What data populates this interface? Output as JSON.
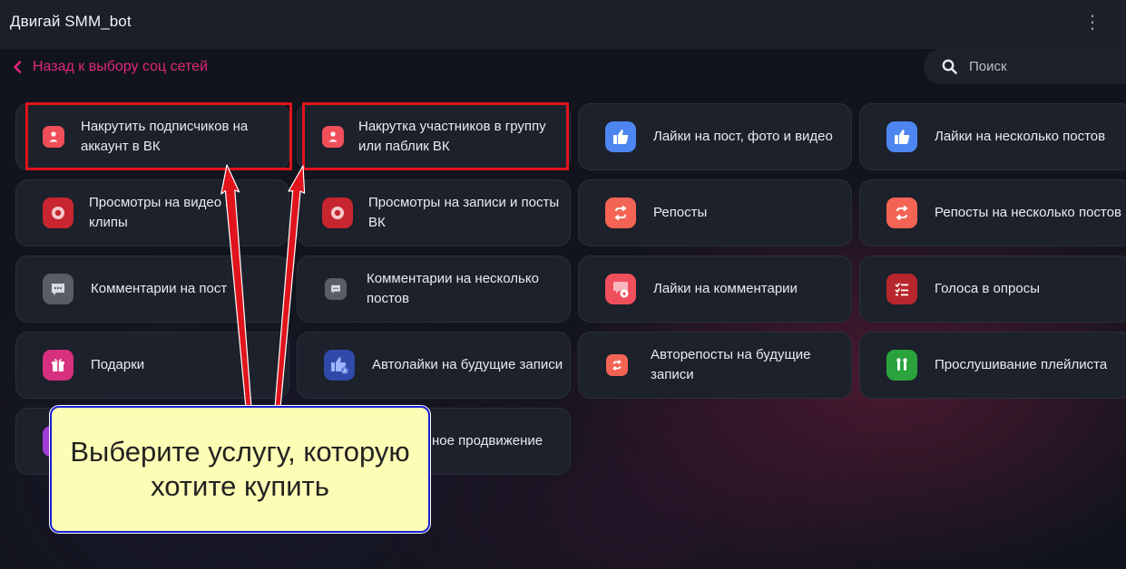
{
  "header": {
    "title": "Двигай SMM_bot",
    "menu_icon": "more-vertical-icon"
  },
  "back_link": {
    "label": "Назад к выбору соц сетей",
    "color": "#e0287a"
  },
  "search": {
    "placeholder": "Поиск"
  },
  "services": [
    {
      "label1": "Накрутить подписчиков на",
      "label2": "аккаунт в ВК",
      "icon": "user-icon"
    },
    {
      "label1": "Накрутка участников в группу",
      "label2": "или паблик ВК",
      "icon": "user-icon"
    },
    {
      "label1": "Лайки на пост, фото и видео",
      "icon": "thumbs-up-icon"
    },
    {
      "label1": "Лайки на несколько постов",
      "icon": "thumbs-up-icon"
    },
    {
      "label1": "Просмотры на видео и",
      "label2": "клипы",
      "icon": "eye-icon"
    },
    {
      "label1": "Просмотры на записи и посты",
      "label2": "ВК",
      "icon": "eye-icon"
    },
    {
      "label1": "Репосты",
      "icon": "repost-icon"
    },
    {
      "label1": "Репосты на несколько постов",
      "icon": "repost-icon"
    },
    {
      "label1": "Комментарии на пост",
      "icon": "comment-icon"
    },
    {
      "label1": "Комментарии на несколько",
      "label2": "постов",
      "icon": "comment-icon"
    },
    {
      "label1": "Лайки на комментарии",
      "icon": "comment-like-icon"
    },
    {
      "label1": "Голоса в опросы",
      "icon": "poll-icon"
    },
    {
      "label1": "Подарки",
      "icon": "gift-icon"
    },
    {
      "label1": "Автолайки на будущие записи",
      "icon": "auto-like-icon"
    },
    {
      "label1": "Авторепосты на будущие",
      "label2": "записи",
      "icon": "auto-repost-icon"
    },
    {
      "label1": "Прослушивание плейлиста",
      "icon": "headphones-icon"
    },
    {
      "label1": "",
      "icon": "promo-icon"
    },
    {
      "label1": "ное продвижение",
      "icon": ""
    }
  ],
  "callout": {
    "text": "Выберите услугу, которую\nхотите купить",
    "bg": "#fdfdb5",
    "border": "#1a1fd6"
  },
  "colors": {
    "highlight": "#e0141c",
    "arrow": "#e0141c"
  }
}
